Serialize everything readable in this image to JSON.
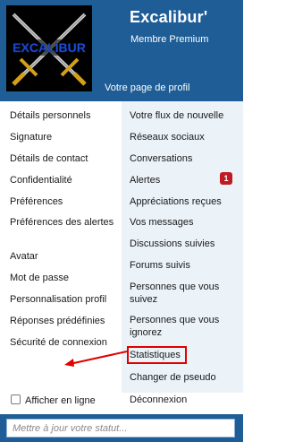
{
  "header": {
    "username": "Excalibur'",
    "user_title": "Membre Premium",
    "profile_link": "Votre page de profil",
    "avatar_text": "EXCALIBUR"
  },
  "left_menu": [
    {
      "label": "Détails personnels"
    },
    {
      "label": "Signature"
    },
    {
      "label": "Détails de contact"
    },
    {
      "label": "Confidentialité"
    },
    {
      "label": "Préférences"
    },
    {
      "label": "Préférences des alertes"
    },
    {
      "label": "Avatar"
    },
    {
      "label": "Mot de passe"
    },
    {
      "label": "Personnalisation profil"
    },
    {
      "label": "Réponses prédéfinies"
    },
    {
      "label": "Sécurité de connexion"
    }
  ],
  "right_menu": [
    {
      "label": "Votre flux de nouvelle"
    },
    {
      "label": "Réseaux sociaux"
    },
    {
      "label": "Conversations"
    },
    {
      "label": "Alertes",
      "badge": "1"
    },
    {
      "label": "Appréciations reçues"
    },
    {
      "label": "Vos messages"
    },
    {
      "label": "Discussions suivies"
    },
    {
      "label": "Forums suivis"
    },
    {
      "label": "Personnes que vous suivez"
    },
    {
      "label": "Personnes que vous ignorez"
    },
    {
      "label": "Statistiques"
    },
    {
      "label": "Changer de pseudo"
    }
  ],
  "footer": {
    "online_checkbox_label": "Afficher en ligne",
    "online_checked": false,
    "logout_label": "Déconnexion",
    "status_placeholder": "Mettre à jour votre statut..."
  },
  "colors": {
    "header_bg": "#1f5d96",
    "right_column_bg": "#ebf2f8",
    "badge_bg": "#c01b22",
    "annotation": "#e00000"
  }
}
